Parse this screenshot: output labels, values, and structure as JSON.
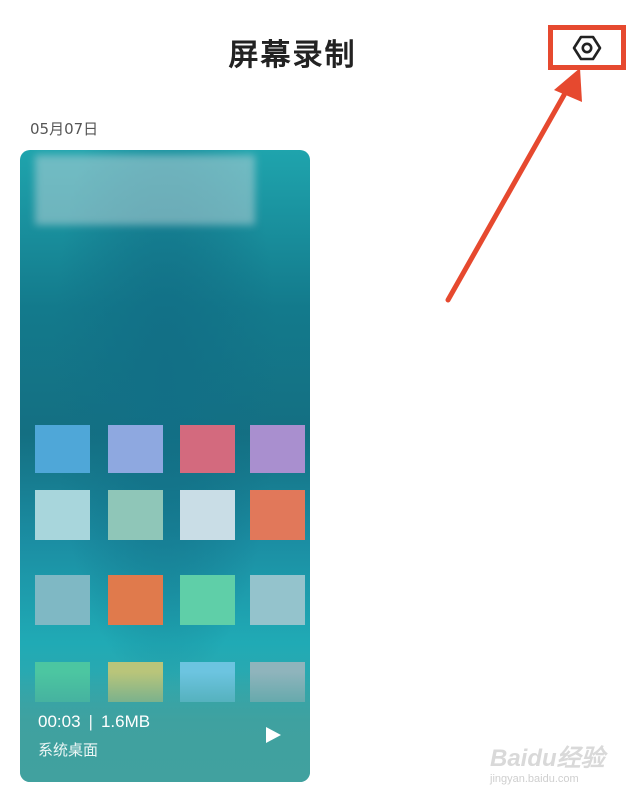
{
  "header": {
    "title": "屏幕录制",
    "settings_icon": "settings-icon"
  },
  "recordings": [
    {
      "date": "05月07日",
      "duration": "00:03",
      "size": "1.6MB",
      "name": "系统桌面",
      "play_icon": "play-icon"
    }
  ],
  "annotation": {
    "highlight_color": "#e6492f"
  },
  "watermark": {
    "logo": "Baidu经验",
    "url": "jingyan.baidu.com"
  }
}
